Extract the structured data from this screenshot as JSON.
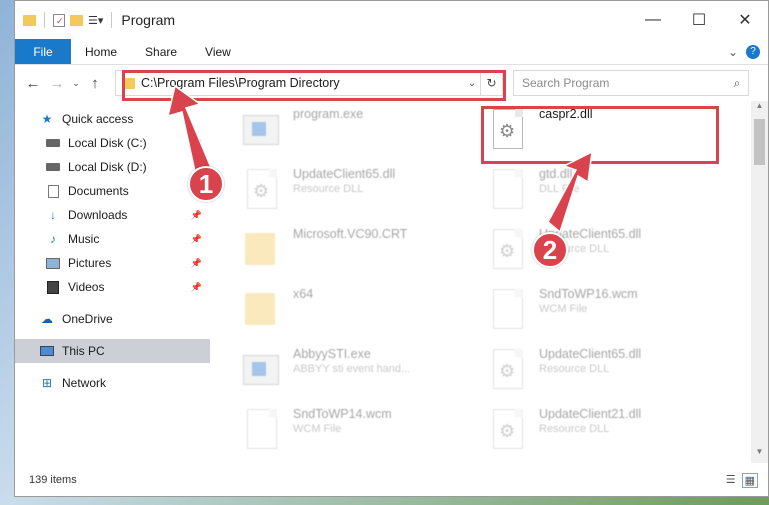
{
  "window": {
    "title": "Program"
  },
  "ribbon": {
    "file": "File",
    "tabs": [
      "Home",
      "Share",
      "View"
    ]
  },
  "address": {
    "path": "C:\\Program Files\\Program Directory"
  },
  "search": {
    "placeholder": "Search Program"
  },
  "sidebar": {
    "items": [
      {
        "label": "Quick access",
        "icon": "star-icon",
        "pinned": false
      },
      {
        "label": "Local Disk (C:)",
        "icon": "drive-icon",
        "pinned": true
      },
      {
        "label": "Local Disk (D:)",
        "icon": "drive-icon",
        "pinned": false
      },
      {
        "label": "Documents",
        "icon": "documents-icon",
        "pinned": false
      },
      {
        "label": "Downloads",
        "icon": "download-icon",
        "pinned": true
      },
      {
        "label": "Music",
        "icon": "music-icon",
        "pinned": true
      },
      {
        "label": "Pictures",
        "icon": "pictures-icon",
        "pinned": true
      },
      {
        "label": "Videos",
        "icon": "videos-icon",
        "pinned": true
      },
      {
        "label": "OneDrive",
        "icon": "cloud-icon",
        "pinned": false
      },
      {
        "label": "This PC",
        "icon": "pc-icon",
        "pinned": false
      },
      {
        "label": "Network",
        "icon": "network-icon",
        "pinned": false
      }
    ]
  },
  "files": [
    {
      "name": "program.exe",
      "type": ""
    },
    {
      "name": "caspr2.dll",
      "type": ""
    },
    {
      "name": "UpdateClient65.dll",
      "type": "Resource DLL"
    },
    {
      "name": "gtd.dll",
      "type": "DLL File"
    },
    {
      "name": "Microsoft.VC90.CRT",
      "type": ""
    },
    {
      "name": "UpdateClient65.dll",
      "type": "Resource DLL"
    },
    {
      "name": "x64",
      "type": ""
    },
    {
      "name": "SndToWP16.wcm",
      "type": "WCM File"
    },
    {
      "name": "AbbyySTI.exe",
      "type": "ABBYY sti event hand..."
    },
    {
      "name": "UpdateClient65.dll",
      "type": "Resource DLL"
    },
    {
      "name": "SndToWP14.wcm",
      "type": "WCM File"
    },
    {
      "name": "UpdateClient21.dll",
      "type": "Resource DLL"
    }
  ],
  "status": {
    "count": "139 items"
  },
  "annotations": {
    "badge1": "1",
    "badge2": "2"
  },
  "colors": {
    "highlight": "#d8434e",
    "accent": "#1979ca"
  }
}
